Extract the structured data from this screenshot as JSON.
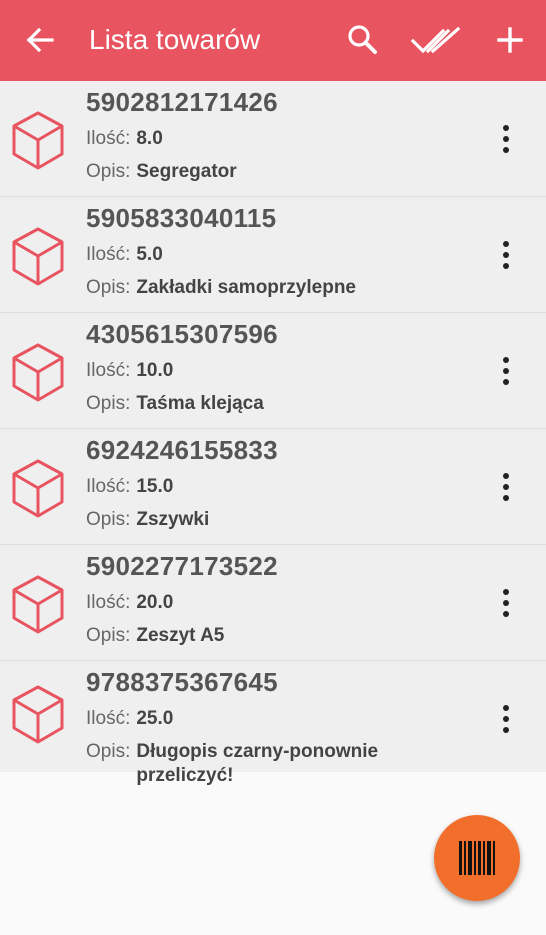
{
  "appbar": {
    "title": "Lista towarów",
    "icons": [
      "back-arrow-icon",
      "search-icon",
      "double-check-icon",
      "plus-icon"
    ],
    "color": "#e8545f"
  },
  "labels": {
    "quantity": "Ilość:",
    "description": "Opis:"
  },
  "items": [
    {
      "code": "5902812171426",
      "quantity": "8.0",
      "description": "Segregator"
    },
    {
      "code": "5905833040115",
      "quantity": "5.0",
      "description": "Zakładki samoprzylepne"
    },
    {
      "code": "4305615307596",
      "quantity": "10.0",
      "description": "Taśma klejąca"
    },
    {
      "code": "6924246155833",
      "quantity": "15.0",
      "description": "Zszywki"
    },
    {
      "code": "5902277173522",
      "quantity": "20.0",
      "description": "Zeszyt A5"
    },
    {
      "code": "9788375367645",
      "quantity": "25.0",
      "description": "Długopis czarny-ponownie przeliczyć!"
    }
  ],
  "fab": {
    "icon": "barcode-icon",
    "color": "#f26f2b"
  },
  "colors": {
    "accent": "#e8545f",
    "list_bg": "#efefef",
    "page_bg": "#fafafa"
  }
}
